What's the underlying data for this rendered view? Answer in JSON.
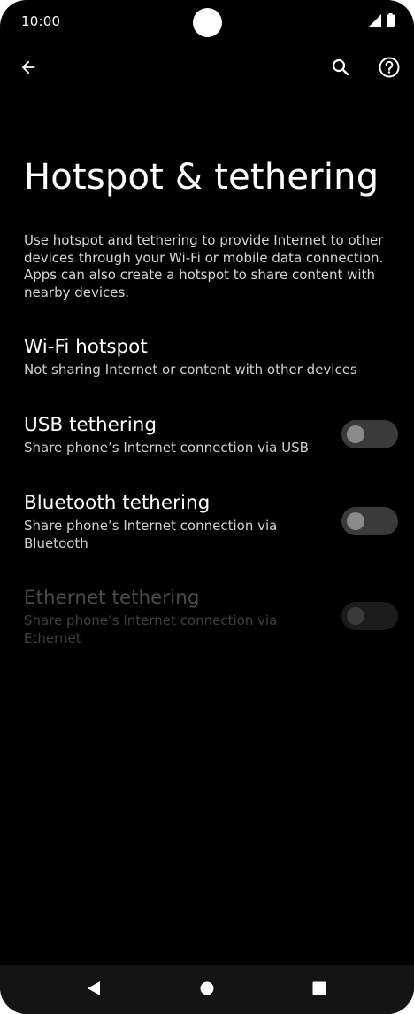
{
  "status_bar": {
    "time": "10:00",
    "icons": [
      "signal-icon",
      "battery-icon"
    ]
  },
  "app_bar": {
    "back_icon": "arrow-back-icon",
    "search_icon": "search-icon",
    "help_icon": "help-icon"
  },
  "page": {
    "title": "Hotspot & tethering",
    "description": "Use hotspot and tethering to provide Internet to other devices through your Wi-Fi or mobile data connection. Apps can also create a hotspot to share content with nearby devices."
  },
  "items": [
    {
      "title": "Wi-Fi hotspot",
      "summary": "Not sharing Internet or content with other devices",
      "has_switch": false,
      "enabled": true
    },
    {
      "title": "USB tethering",
      "summary": "Share phone’s Internet connection via USB",
      "has_switch": true,
      "checked": false,
      "enabled": true
    },
    {
      "title": "Bluetooth tethering",
      "summary": "Share phone’s Internet connection via Bluetooth",
      "has_switch": true,
      "checked": false,
      "enabled": true
    },
    {
      "title": "Ethernet tethering",
      "summary": "Share phone’s Internet connection via Ethernet",
      "has_switch": true,
      "checked": false,
      "enabled": false
    }
  ],
  "nav_bar": {
    "back_icon": "nav-back-icon",
    "home_icon": "nav-home-icon",
    "recents_icon": "nav-recents-icon"
  },
  "colors": {
    "background": "#000000",
    "text_primary": "#ffffff",
    "text_secondary": "#cfcfcf",
    "text_disabled": "#4a4a4a",
    "switch_track_off": "#3a3a3a",
    "switch_thumb_off": "#8a8a8a",
    "nav_bar": "#141414"
  }
}
